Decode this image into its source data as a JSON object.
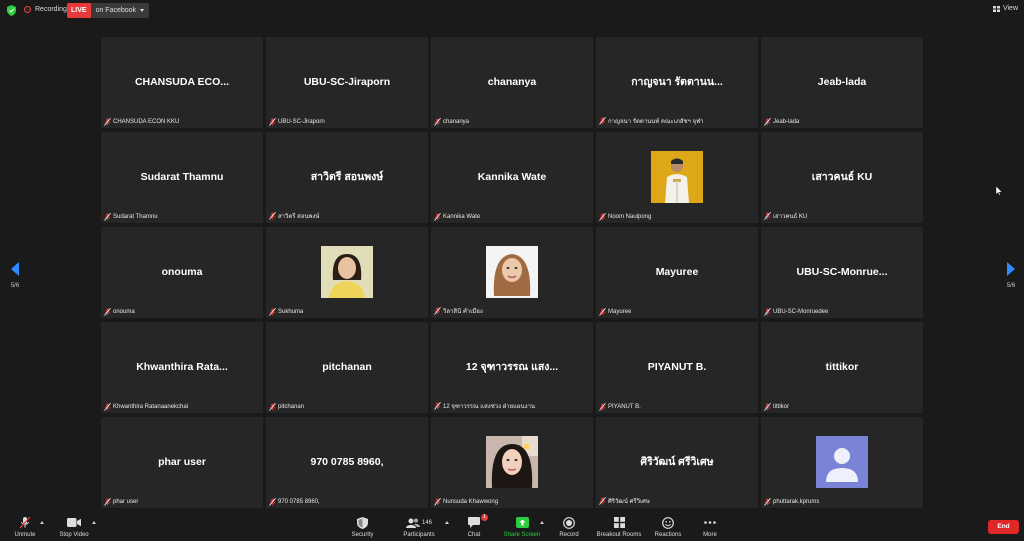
{
  "topbar": {
    "recording_label": "Recording",
    "live_label": "LIVE",
    "live_target": "on Facebook",
    "view_label": "View"
  },
  "pagination": {
    "left": "5/6",
    "right": "5/6"
  },
  "tiles": [
    {
      "name": "CHANSUDA  ECO...",
      "label": "CHANSUDA ECON KKU"
    },
    {
      "name": "UBU-SC-Jiraporn",
      "label": "UBU-SC-Jiraporn"
    },
    {
      "name": "chananya",
      "label": "chananya"
    },
    {
      "name": "กาญจนา รัตตานน...",
      "label": "กาญจนา รัตตานนท์ คณะเภสัชฯ จุฬา"
    },
    {
      "name": "Jeab-lada",
      "label": "Jeab-lada"
    },
    {
      "name": "Sudarat Thamnu",
      "label": "Sudarat Thamnu"
    },
    {
      "name": "สาวิตรี สอนพงษ์",
      "label": "สาวิตรี สอนพงษ์"
    },
    {
      "name": "Kannika Wate",
      "label": "Kannika Wate"
    },
    {
      "name": "",
      "label": "Noom Naulpong",
      "photo": "man-uniform"
    },
    {
      "name": "เสาวคนธ์ KU",
      "label": "เสาวคนธ์ KU"
    },
    {
      "name": "onouma",
      "label": "onouma"
    },
    {
      "name": "",
      "label": "Sukhuma",
      "photo": "woman-yellow"
    },
    {
      "name": "",
      "label": "วิลาสินี คำเมือง",
      "photo": "woman-white-bg"
    },
    {
      "name": "Mayuree",
      "label": "Mayuree"
    },
    {
      "name": "UBU-SC-Monrue...",
      "label": "UBU-SC-Monruedee"
    },
    {
      "name": "Khwanthira  Rata...",
      "label": "Khwanthira Ratanaanekchai"
    },
    {
      "name": "pitchanan",
      "label": "pitchanan"
    },
    {
      "name": "12 จุฑาวรรณ แสง...",
      "label": "12 จุฑาวรรณ แสงช่วง ฝ่ายแผนงาน"
    },
    {
      "name": "PIYANUT B.",
      "label": "PIYANUT B."
    },
    {
      "name": "tittikor",
      "label": "tittikor"
    },
    {
      "name": "phar user",
      "label": "phar user"
    },
    {
      "name": "970 0785 8960,",
      "label": "970 0785 8960,"
    },
    {
      "name": "",
      "label": "Nunsuda Khawwong",
      "photo": "woman-selfie"
    },
    {
      "name": "ศิริวัฒน์ ศรีวิเศษ",
      "label": "ศิริวัฒน์ ศรีวิเศษ"
    },
    {
      "name": "",
      "label": "phuttarak.kprums",
      "photo": "default-avatar"
    }
  ],
  "toolbar": {
    "unmute": "Unmute",
    "stop_video": "Stop Video",
    "security": "Security",
    "participants": "Participants",
    "participants_count": "146",
    "chat": "Chat",
    "chat_badge": "1",
    "share_screen": "Share Screen",
    "record": "Record",
    "breakout": "Breakout Rooms",
    "reactions": "Reactions",
    "more": "More",
    "end": "End"
  },
  "colors": {
    "accent": "#2d8cff",
    "live_red": "#e83a3a",
    "end_red": "#e02828",
    "share_green": "#2ecc40",
    "tile_bg": "#262626",
    "bg": "#1a1a1a"
  }
}
